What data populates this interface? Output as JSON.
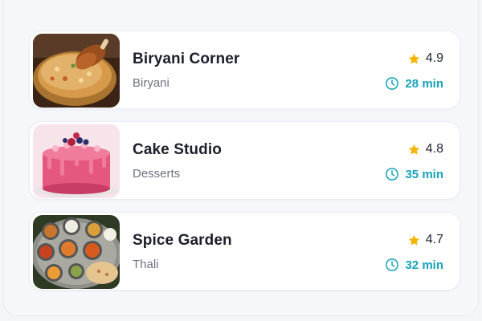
{
  "restaurants": [
    {
      "name": "Biryani Corner",
      "category": "Biryani",
      "rating": "4.9",
      "time": "28 min",
      "image": "biryani-bowl"
    },
    {
      "name": "Cake Studio",
      "category": "Desserts",
      "rating": "4.8",
      "time": "35 min",
      "image": "pink-drip-cake"
    },
    {
      "name": "Spice Garden",
      "category": "Thali",
      "rating": "4.7",
      "time": "32 min",
      "image": "thali-platter"
    }
  ],
  "icons": {
    "rating": "star-icon",
    "delivery_time": "clock-icon"
  },
  "colors": {
    "star": "#f5b400",
    "time": "#14a3b8",
    "title": "#1b1f2a",
    "category": "#6b7280"
  }
}
